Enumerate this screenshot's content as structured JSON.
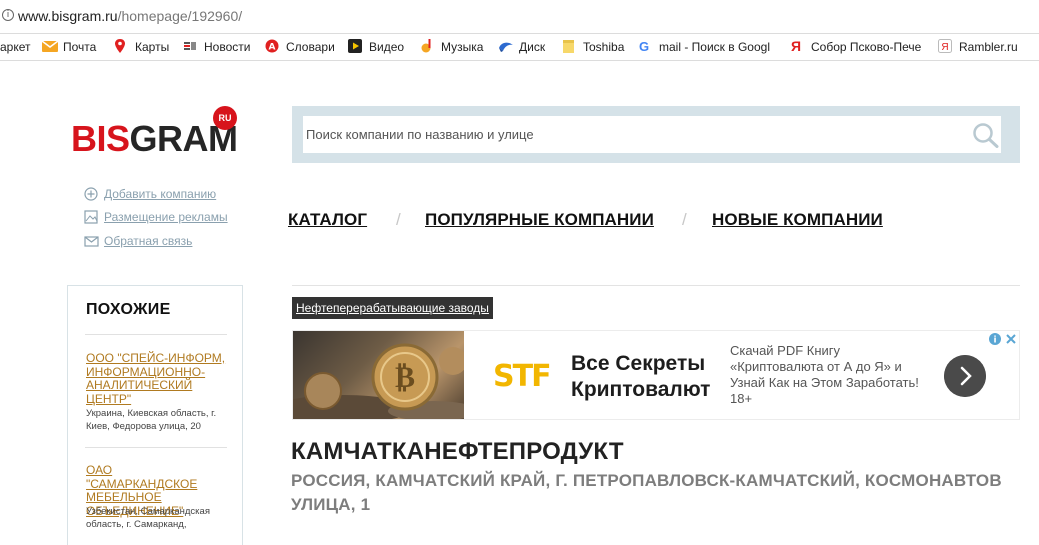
{
  "browser": {
    "url_host": "www.bisgram.ru",
    "url_path": "/homepage/192960/",
    "bookmarks": [
      {
        "label": "аркет",
        "icon": "market-icon"
      },
      {
        "label": "Почта",
        "icon": "mail-icon",
        "color": "#f5a623"
      },
      {
        "label": "Карты",
        "icon": "map-pin-icon",
        "color": "#e02020"
      },
      {
        "label": "Новости",
        "icon": "news-icon"
      },
      {
        "label": "Словари",
        "icon": "dictionary-icon"
      },
      {
        "label": "Видео",
        "icon": "video-icon"
      },
      {
        "label": "Музыка",
        "icon": "music-icon"
      },
      {
        "label": "Диск",
        "icon": "disk-icon"
      },
      {
        "label": "Toshiba",
        "icon": "folder-icon"
      },
      {
        "label": "mail - Поиск в Googl",
        "icon": "google-icon"
      },
      {
        "label": "Собор Псково-Пече",
        "icon": "yandex-icon"
      },
      {
        "label": "Rambler.ru",
        "icon": "rambler-icon"
      }
    ]
  },
  "site": {
    "logo_part1": "BIS",
    "logo_part2": "GRAM",
    "logo_badge": "RU",
    "search_placeholder": "Поиск компании по названию и улице",
    "side_links": [
      {
        "label": "Добавить компанию",
        "icon": "plus-circle-icon"
      },
      {
        "label": "Размещение рекламы",
        "icon": "image-icon"
      },
      {
        "label": "Обратная связь",
        "icon": "envelope-icon"
      }
    ],
    "nav": [
      "КАТАЛОГ",
      "ПОПУЛЯРНЫЕ КОМПАНИИ",
      "НОВЫЕ КОМПАНИИ"
    ],
    "nav_separator": "/"
  },
  "similar": {
    "title": "ПОХОЖИЕ",
    "items": [
      {
        "name": "ООО \"СПЕЙС-ИНФОРМ, ИНФОРМАЦИОННО-АНАЛИТИЧЕСКИЙ ЦЕНТР\"",
        "address": "Украина, Киевская область, г. Киев, Федорова улица, 20"
      },
      {
        "name": "ОАО \"САМАРКАНДСКОЕ МЕБЕЛЬНОЕ ОБЪЕДИНЕНИЕ\"",
        "address": "Узбекистан, Самаркандская область, г. Самарканд,"
      }
    ]
  },
  "breadcrumb": "Нефтеперерабатывающие заводы",
  "ad": {
    "logo_text": "STF",
    "headline": "Все Секреты Криптовалют",
    "body": "Скачай PDF Книгу «Криптовалюта от А до Я» и Узнай Как на Этом Заработать! 18+"
  },
  "company": {
    "name": "КАМЧАТКАНЕФТЕПРОДУКТ",
    "address": "РОССИЯ, КАМЧАТСКИЙ КРАЙ, Г. ПЕТРОПАВЛОВСК-КАМЧАТСКИЙ, КОСМОНАВТОВ УЛИЦА, 1"
  }
}
